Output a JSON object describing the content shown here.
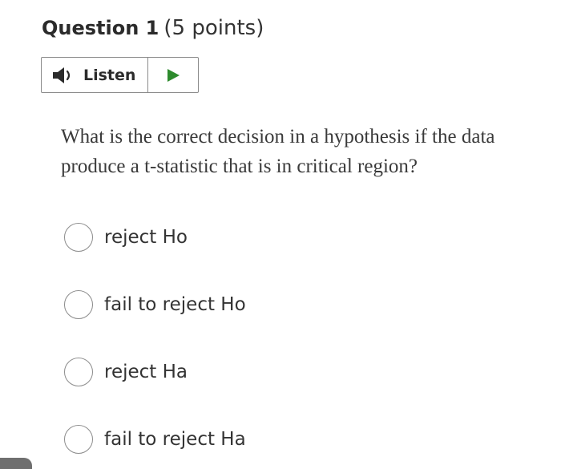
{
  "question": {
    "title": "Question 1",
    "points": "(5 points)",
    "text": "What is the correct decision in a hypothesis if the data produce a t-statistic that is in critical region?"
  },
  "listen": {
    "label": "Listen",
    "speaker_icon": "speaker-icon",
    "play_icon": "play-icon",
    "play_color": "#2e8b2e"
  },
  "options": [
    {
      "label": "reject Ho",
      "selected": false
    },
    {
      "label": "fail to reject Ho",
      "selected": false
    },
    {
      "label": "reject Ha",
      "selected": false
    },
    {
      "label": "fail to reject Ha",
      "selected": false
    }
  ]
}
